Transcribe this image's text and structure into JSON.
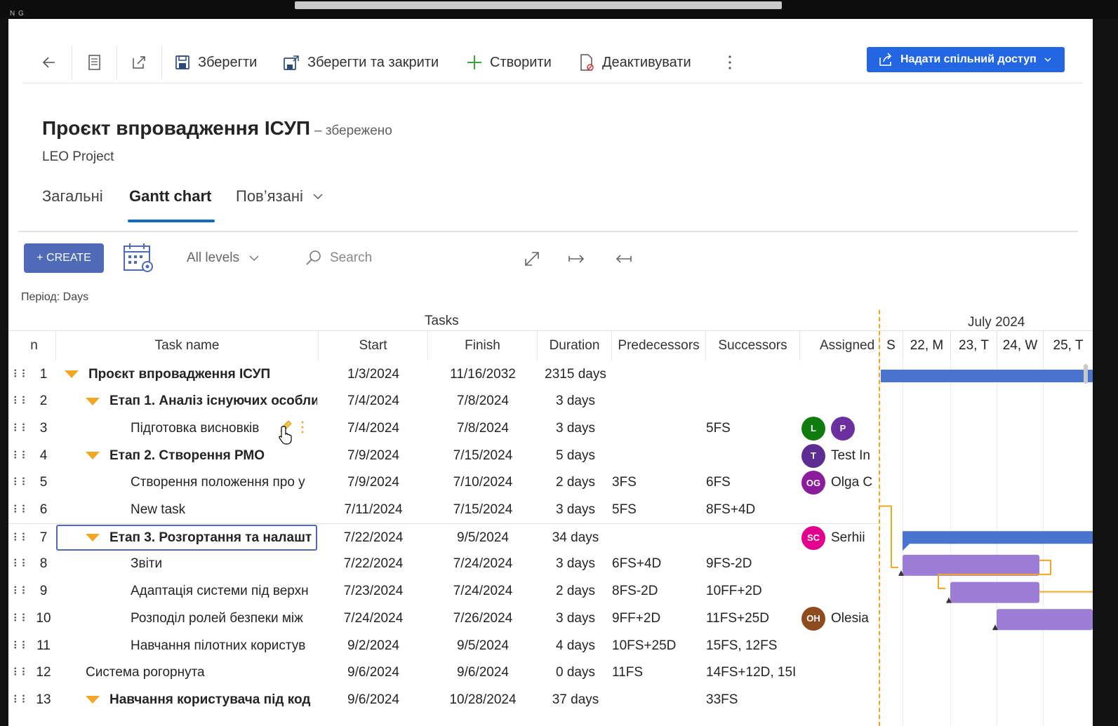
{
  "window": {
    "corner_label": "N G"
  },
  "toolbar": {
    "save": "Зберегти",
    "save_close": "Зберегти та закрити",
    "create": "Створити",
    "deactivate": "Деактивувати",
    "share": "Надати спільний доступ"
  },
  "record": {
    "title": "Проєкт впровадження ІСУП",
    "status": "– збережено",
    "entity": "LEO Project"
  },
  "tabs": [
    {
      "label": "Загальні"
    },
    {
      "label": "Gantt chart"
    },
    {
      "label": "Пов’язані"
    }
  ],
  "gantt": {
    "create_label": "+ CREATE",
    "levels_label": "All levels",
    "search_placeholder": "Search",
    "period_label": "Період:",
    "period_value": "Days",
    "tasks_caption": "Tasks",
    "columns": {
      "n": "n",
      "name": "Task name",
      "start": "Start",
      "finish": "Finish",
      "duration": "Duration",
      "predecessors": "Predecessors",
      "successors": "Successors",
      "assigned": "Assigned"
    },
    "timeline": {
      "month": "July 2024",
      "days": [
        "S",
        "22, M",
        "23, T",
        "24, W",
        "25, T"
      ]
    },
    "rows": [
      {
        "n": "1",
        "name": "Проєкт впровадження ІСУП",
        "start": "1/3/2024",
        "finish": "11/16/2032",
        "duration": "2315 days",
        "pred": "",
        "succ": "",
        "assigned": ""
      },
      {
        "n": "2",
        "name": "Етап 1. Аналіз існуючих особли",
        "start": "7/4/2024",
        "finish": "7/8/2024",
        "duration": "3 days",
        "pred": "",
        "succ": "",
        "assigned": ""
      },
      {
        "n": "3",
        "name": "Підготовка висновків",
        "start": "7/4/2024",
        "finish": "7/8/2024",
        "duration": "3 days",
        "pred": "",
        "succ": "5FS",
        "assigned": "",
        "avatars": [
          {
            "initials": "L",
            "color": "#107c10"
          },
          {
            "initials": "P",
            "color": "#6b2fa0"
          }
        ]
      },
      {
        "n": "4",
        "name": "Етап 2. Створення РМО",
        "start": "7/9/2024",
        "finish": "7/15/2024",
        "duration": "5 days",
        "pred": "",
        "succ": "",
        "assigned": "Test In",
        "avatars": [
          {
            "initials": "T",
            "color": "#5c2e91"
          }
        ]
      },
      {
        "n": "5",
        "name": "Створення положення про у",
        "start": "7/9/2024",
        "finish": "7/10/2024",
        "duration": "2 days",
        "pred": "3FS",
        "succ": "6FS",
        "assigned": "Olga C",
        "avatars": [
          {
            "initials": "OG",
            "color": "#8b1d9c"
          }
        ]
      },
      {
        "n": "6",
        "name": "New task",
        "start": "7/11/2024",
        "finish": "7/15/2024",
        "duration": "3 days",
        "pred": "5FS",
        "succ": "8FS+4D",
        "assigned": ""
      },
      {
        "n": "7",
        "name": "Етап 3. Розгортання та налашт",
        "start": "7/22/2024",
        "finish": "9/5/2024",
        "duration": "34 days",
        "pred": "",
        "succ": "",
        "assigned": "Serhii",
        "avatars": [
          {
            "initials": "SC",
            "color": "#e3008c"
          }
        ]
      },
      {
        "n": "8",
        "name": "Звіти",
        "start": "7/22/2024",
        "finish": "7/24/2024",
        "duration": "3 days",
        "pred": "6FS+4D",
        "succ": "9FS-2D",
        "assigned": ""
      },
      {
        "n": "9",
        "name": "Адаптація системи під верхн",
        "start": "7/23/2024",
        "finish": "7/24/2024",
        "duration": "2 days",
        "pred": "8FS-2D",
        "succ": "10FF+2D",
        "assigned": ""
      },
      {
        "n": "10",
        "name": "Розподіл ролей безпеки між",
        "start": "7/24/2024",
        "finish": "7/26/2024",
        "duration": "3 days",
        "pred": "9FF+2D",
        "succ": "11FS+25D",
        "assigned": "Olesia",
        "avatars": [
          {
            "initials": "OH",
            "color": "#8e4b1f"
          }
        ]
      },
      {
        "n": "11",
        "name": "Навчання пілотних користув",
        "start": "9/2/2024",
        "finish": "9/5/2024",
        "duration": "4 days",
        "pred": "10FS+25D",
        "succ": "15FS, 12FS",
        "assigned": ""
      },
      {
        "n": "12",
        "name": "Система рогорнута",
        "start": "9/6/2024",
        "finish": "9/6/2024",
        "duration": "0 days",
        "pred": "11FS",
        "succ": "14FS+12D, 15I",
        "assigned": ""
      },
      {
        "n": "13",
        "name": "Навчання користувача під код",
        "start": "9/6/2024",
        "finish": "10/28/2024",
        "duration": "37 days",
        "pred": "",
        "succ": "33FS",
        "assigned": ""
      }
    ]
  },
  "colors": {
    "accent": "#2266e3",
    "create": "#4f6bb7",
    "summary_bar": "#4a74cf",
    "task_bar": "#9d7ed6",
    "today": "#f2a626"
  }
}
